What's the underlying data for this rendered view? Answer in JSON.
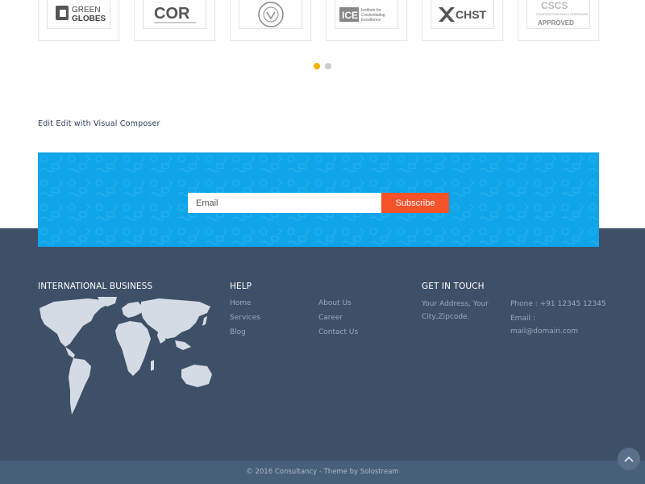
{
  "logos": [
    {
      "name": "green-globes-logo",
      "text": "GREEN\nGLOBES"
    },
    {
      "name": "cor-logo",
      "text": "COR"
    },
    {
      "name": "seal-logo",
      "text": ""
    },
    {
      "name": "ice-logo",
      "text": "ICE Institute for Credentialing Excellence"
    },
    {
      "name": "chst-logo",
      "text": "CHST"
    },
    {
      "name": "cscs-logo",
      "text": "CSCS APPROVED"
    }
  ],
  "carousel": {
    "dots": 2,
    "active": 0
  },
  "edit_link": "Edit Edit with Visual Composer",
  "newsletter": {
    "placeholder": "Email",
    "button": "Subscribe"
  },
  "footer": {
    "international_title": "INTERNATIONAL BUSINESS",
    "help_title": "HELP",
    "help_links_col1": [
      "Home",
      "Services",
      "Blog"
    ],
    "help_links_col2": [
      "About Us",
      "Career",
      "Contact Us"
    ],
    "contact_title": "GET IN TOUCH",
    "address_line1": "Your Address, Your",
    "address_line2": "City,Zipcode.",
    "phone": "Phone : +91 12345 12345",
    "email_label": "Email :",
    "email_value": "mail@domain.com"
  },
  "copyright": "© 2016 Consultancy - Theme by Solostream",
  "colors": {
    "accent": "#10a5e8",
    "button": "#f5522a",
    "footer": "#3e5068",
    "dot_active": "#f5b400"
  }
}
